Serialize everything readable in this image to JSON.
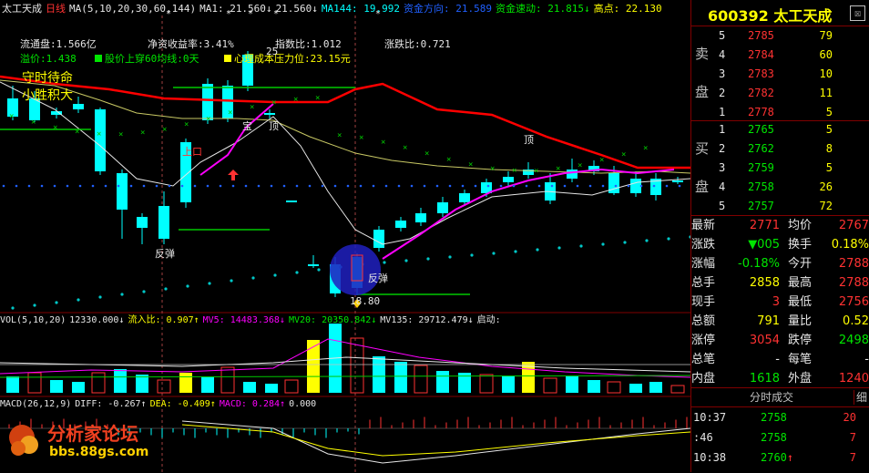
{
  "header": {
    "stock_name": "太工天成",
    "period": "日线",
    "ma_label": "MA(5,10,20,30,60,144)",
    "ma1": "MA1: 21.560↓",
    "ma2": "21.560↓",
    "ma144": "MA144: 19.992",
    "capital_label": "资金方向: 21.589",
    "speed_label": "资金速动: 21.815↓",
    "high_label": "高点: 22.130"
  },
  "info": {
    "float_cap": "流通盘:1.566亿",
    "roe": "净资收益率:3.41%",
    "index_ratio": "指数比:1.012",
    "updown_ratio": "涨跌比:0.721",
    "premium": "溢价:1.438",
    "above_ma60": "股价上穿60均线:0天",
    "cost_pressure": "心理成本压力位:23.15元",
    "slogan1": "守时待命",
    "slogan2": "小胜积大"
  },
  "annotations": {
    "rebound1": "反弹",
    "rebound2": "反弹",
    "up": "上口",
    "top1": "顶",
    "top2": "顶",
    "bao": "宝",
    "low": "18.80",
    "num25": "25"
  },
  "vol": {
    "label": "VOL(5,10,20)",
    "value": "12330.000↓",
    "inflow": "流入比: 0.907↑",
    "mv5": "MV5: 14483.368↓",
    "mv20": "MV20: 20350.842↓",
    "mv135": "MV135: 29712.479↓",
    "start": "启动:"
  },
  "macd": {
    "label": "MACD(26,12,9)",
    "diff": "DIFF: -0.267↑",
    "dea": "DEA: -0.409↑",
    "macd": "MACD: 0.284↑",
    "zero": "0.000"
  },
  "logo": {
    "name": "分析家论坛",
    "url": "bbs.88gs.com"
  },
  "panel": {
    "code": "600392",
    "name": "太工天成",
    "close": "☒",
    "sell_label1": "卖",
    "sell_label2": "盘",
    "buy_label1": "买",
    "buy_label2": "盘",
    "sell": [
      {
        "level": "5",
        "price": "2785",
        "vol": "79"
      },
      {
        "level": "4",
        "price": "2784",
        "vol": "60"
      },
      {
        "level": "3",
        "price": "2783",
        "vol": "10"
      },
      {
        "level": "2",
        "price": "2782",
        "vol": "11"
      },
      {
        "level": "1",
        "price": "2778",
        "vol": "5"
      }
    ],
    "buy": [
      {
        "level": "1",
        "price": "2765",
        "vol": "5"
      },
      {
        "level": "2",
        "price": "2762",
        "vol": "8"
      },
      {
        "level": "3",
        "price": "2759",
        "vol": "5"
      },
      {
        "level": "4",
        "price": "2758",
        "vol": "26"
      },
      {
        "level": "5",
        "price": "2757",
        "vol": "72"
      }
    ],
    "stats": {
      "latest_label": "最新",
      "latest": "2771",
      "avg_label": "均价",
      "avg": "2767",
      "change_label": "涨跌",
      "change": "▼005",
      "turnover_label": "换手",
      "turnover": "0.18%",
      "pct_label": "涨幅",
      "pct": "-0.18%",
      "open_label": "今开",
      "open": "2788",
      "total_label": "总手",
      "total": "2858",
      "high_label": "最高",
      "high": "2788",
      "now_label": "现手",
      "now": "3",
      "low_label": "最低",
      "low": "2756",
      "amount_label": "总额",
      "amount": "791",
      "qr_label": "量比",
      "qr": "0.52",
      "limitup_label": "涨停",
      "limitup": "3054",
      "limitdown_label": "跌停",
      "limitdown": "2498",
      "trades_label": "总笔",
      "trades": "-",
      "per_label": "每笔",
      "per": "-",
      "inner_label": "内盘",
      "inner": "1618",
      "outer_label": "外盘",
      "outer": "1240"
    },
    "ticks_title": "分时成交",
    "ticks_btn": "细",
    "ticks": [
      {
        "time": "10:37",
        "price": "2758",
        "arrow": "",
        "vol": "20"
      },
      {
        "time": ":46",
        "price": "2758",
        "arrow": "",
        "vol": "7"
      },
      {
        "time": "10:38",
        "price": "2760",
        "arrow": "↑",
        "vol": "7"
      }
    ]
  },
  "colors": {
    "up": "#ff3232",
    "down": "#00ffff",
    "ma_yellow": "#ffff00",
    "ma_magenta": "#ff00ff",
    "ma_red": "#ff0000",
    "frame": "#800000"
  }
}
